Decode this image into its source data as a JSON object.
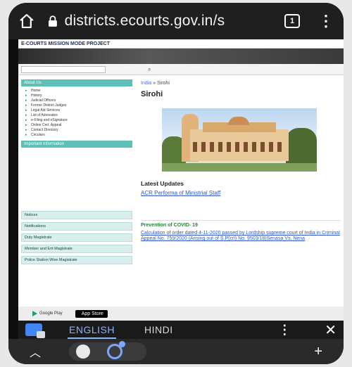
{
  "browser": {
    "url": "districts.ecourts.gov.in/s",
    "tab_count": "1"
  },
  "site": {
    "brand": "E-COURTS MISSION MODE PROJECT",
    "breadcrumb_home": "India",
    "breadcrumb_current": "Sirohi",
    "page_title": "Sirohi",
    "sidebar": {
      "about_head": "About Us",
      "about_items": [
        "Home",
        "History",
        "Judicial Officers",
        "Former District Judges",
        "Legal Aid Services",
        "List of Advocates",
        "e-Filing and eSignature",
        "Online Cert. Appeal",
        "Contact Directory",
        "Circulars"
      ],
      "info_head": "Important Information",
      "buttons": [
        "Notices",
        "Notifications",
        "Duty Magistrate",
        "Member and Ent Magistrate",
        "Police Station Wise Magistrate"
      ]
    },
    "updates_title": "Latest Updates",
    "updates_link": "ACR Performa of Ministrial Staff",
    "covid_title": "Prevention of COVID- 19",
    "covid_text": "Calculation of order dated 4-11-2020 passed by Lordship supreme court of India in Criminal Appeal No. 759/2020 (Arising out of S.P(crl) No. 9503/18)Senasa Vs. Nena",
    "app_store": "App Store",
    "google_play": "Google Play"
  },
  "translate_bar": {
    "lang_active": "ENGLISH",
    "lang_other": "HINDI"
  }
}
